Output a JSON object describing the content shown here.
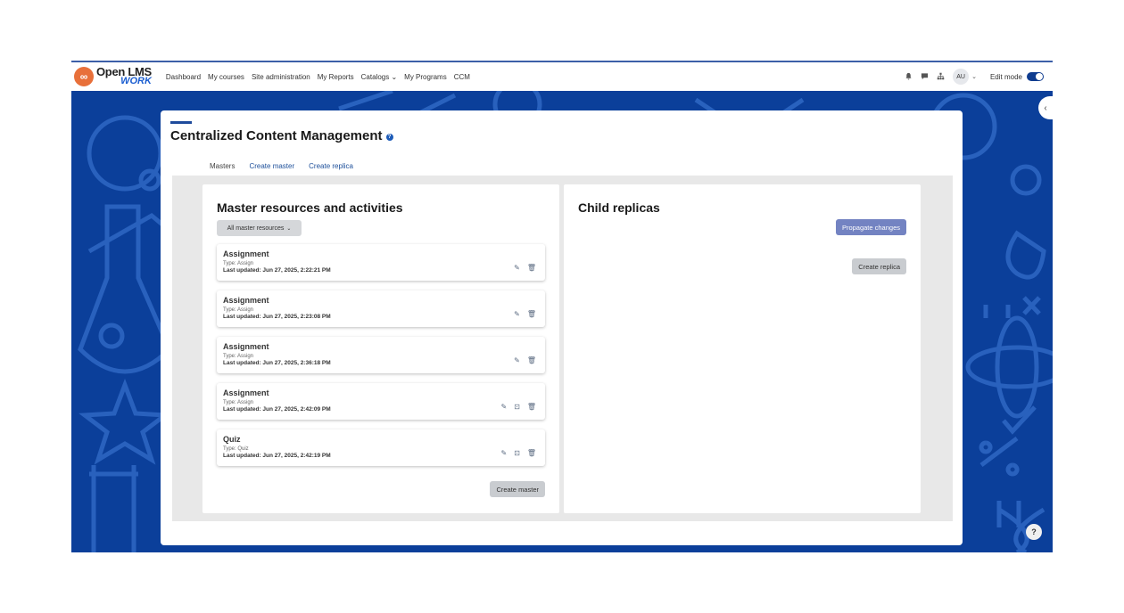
{
  "logo": {
    "top": "Open LMS",
    "bottom": "WORK"
  },
  "nav": [
    {
      "label": "Dashboard"
    },
    {
      "label": "My courses"
    },
    {
      "label": "Site administration"
    },
    {
      "label": "My Reports"
    },
    {
      "label": "Catalogs ⌄"
    },
    {
      "label": "My Programs"
    },
    {
      "label": "CCM"
    }
  ],
  "topbar": {
    "avatar": "AU",
    "edit_mode": "Edit mode"
  },
  "page": {
    "title": "Centralized Content Management"
  },
  "tabs": [
    {
      "label": "Masters",
      "active": true
    },
    {
      "label": "Create master"
    },
    {
      "label": "Create replica"
    }
  ],
  "left_panel": {
    "title": "Master resources and activities",
    "filter": "All master resources",
    "items": [
      {
        "name": "Assignment",
        "type": "Type: Assign",
        "updated": "Last updated: Jun 27, 2025, 2:22:21 PM"
      },
      {
        "name": "Assignment",
        "type": "Type: Assign",
        "updated": "Last updated: Jun 27, 2025, 2:23:08 PM"
      },
      {
        "name": "Assignment",
        "type": "Type: Assign",
        "updated": "Last updated: Jun 27, 2025, 2:36:18 PM"
      },
      {
        "name": "Assignment",
        "type": "Type: Assign",
        "updated": "Last updated: Jun 27, 2025, 2:42:09 PM"
      },
      {
        "name": "Quiz",
        "type": "Type: Quiz",
        "updated": "Last updated: Jun 27, 2025, 2:42:19 PM"
      }
    ],
    "create_master": "Create master"
  },
  "right_panel": {
    "title": "Child replicas",
    "propagate": "Propagate changes",
    "create_replica": "Create replica"
  },
  "colors": {
    "background": "#0b3f9a",
    "accent": "#1e4b9c",
    "propagate_button": "#7383c2"
  }
}
